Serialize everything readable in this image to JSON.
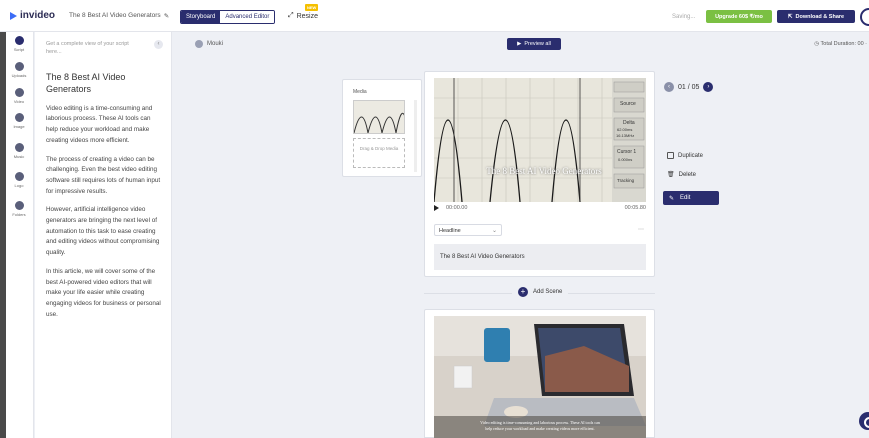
{
  "app": {
    "logo_text": "invideo",
    "doc_title": "The 8 Best AI Video Generators",
    "doc_title_edit_icon": "pencil-icon"
  },
  "toolbar": {
    "mode_storyboard": "Storyboard",
    "mode_advanced": "Advanced Editor",
    "resize_label": "Resize",
    "new_badge": "NEW",
    "saving_label": "Saving...",
    "upgrade_label": "Upgrade 60$ ₹/mo",
    "download_label": "Download & Share"
  },
  "rail": {
    "items": [
      {
        "label": "Script",
        "icon": "script-icon"
      },
      {
        "label": "Uploads",
        "icon": "upload-icon"
      },
      {
        "label": "Video",
        "icon": "video-icon"
      },
      {
        "label": "Image",
        "icon": "image-icon"
      },
      {
        "label": "Music",
        "icon": "music-icon"
      },
      {
        "label": "Logo",
        "icon": "logo-icon"
      },
      {
        "label": "Folders",
        "icon": "folder-icon"
      }
    ]
  },
  "script": {
    "hint": "Get a complete view of your script here...",
    "title": "The 8 Best AI Video Generators",
    "paragraphs": [
      "Video editing is a time-consuming and laborious process. These AI tools can help reduce your workload and make creating videos more efficient.",
      "The process of creating a video can be challenging. Even the best video editing software still requires lots of human input for impressive results.",
      "However, artificial intelligence video generators are bringing the next level of automation to this task to ease creating and editing videos without compromising quality.",
      "In this article, we will cover some of the best AI-powered video editors that will make your life easier while creating engaging videos for business or personal use."
    ]
  },
  "canvas": {
    "voice_label": "Mouki",
    "preview_label": "Preview all",
    "duration_label": "Total Duration: 00 ·"
  },
  "media_panel": {
    "label": "Media",
    "drop_text": "Drag & Drop Media"
  },
  "scene1": {
    "overlay_text": "The 8 Best AI Video Generators",
    "time_current": "00:00.00",
    "time_total": "00:05.80",
    "text_style": "Headline",
    "caption": "The 8 Best AI Video Generators",
    "scope": {
      "source_label": "Source",
      "delta_label": "Delta",
      "delta_val1": "62.00ms",
      "delta_val2": "16.13MHz",
      "cursor_label": "Cursor 1",
      "cursor_val": "0.000ns",
      "tracking_label": "Tracking"
    }
  },
  "pager": {
    "current": "01",
    "total": "05",
    "text": "01 / 05"
  },
  "actions": {
    "duplicate": "Duplicate",
    "delete": "Delete",
    "edit": "Edit"
  },
  "add_scene_label": "Add Scene",
  "scene2": {
    "caption_line1": "Video editing is time-consuming and laborious process. These AI tools can",
    "caption_line2": "help reduce your workload and make creating videos more efficient."
  }
}
